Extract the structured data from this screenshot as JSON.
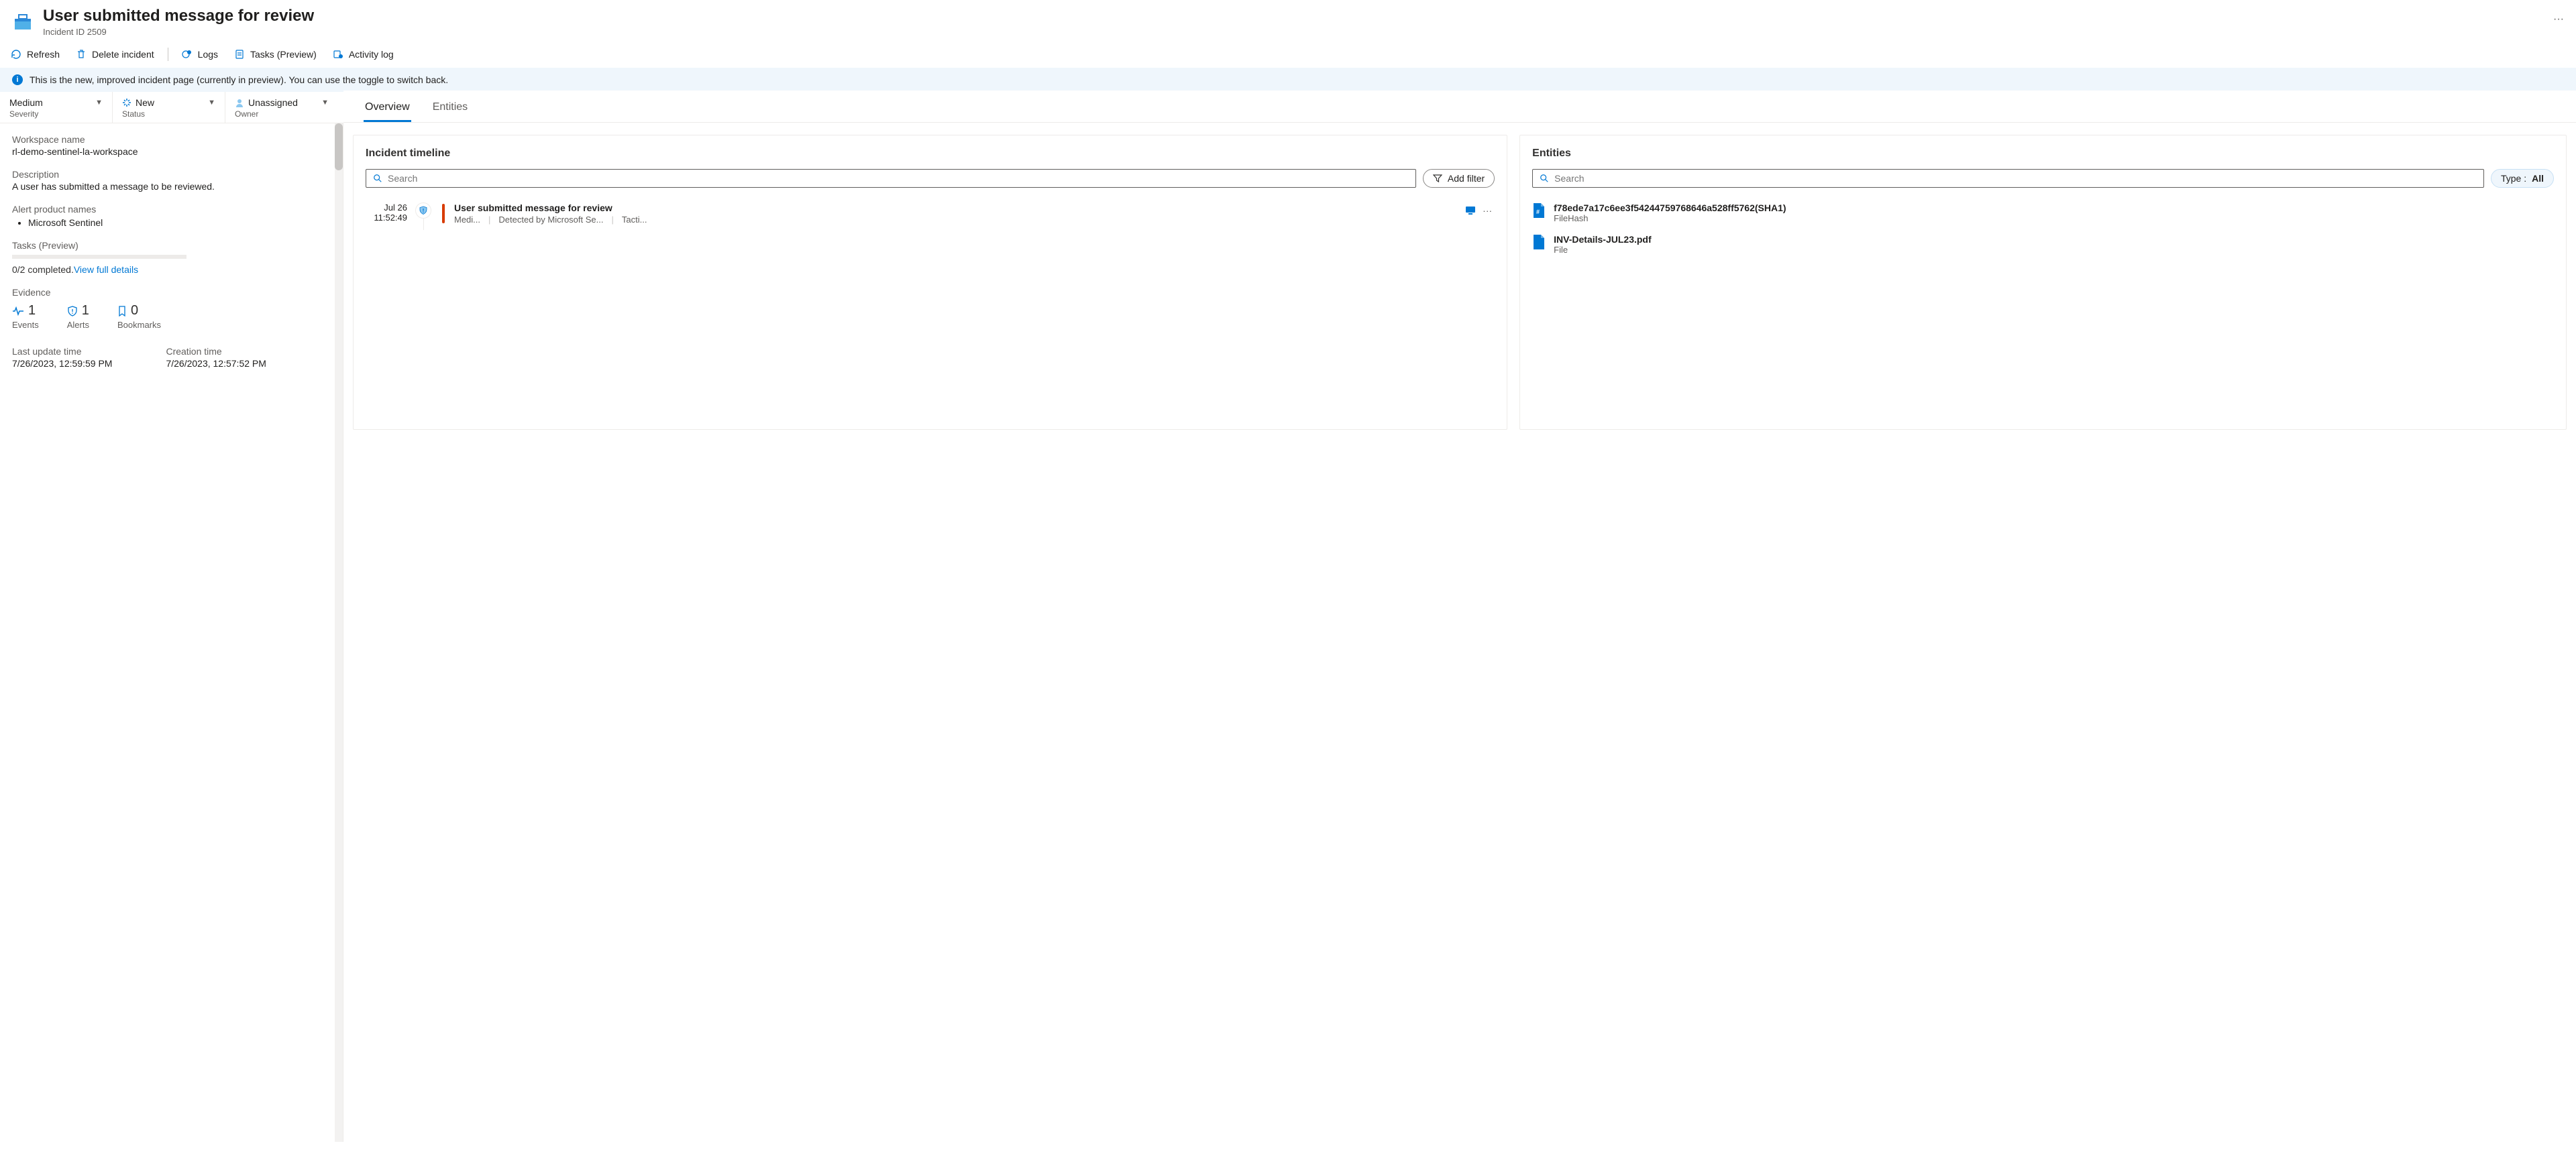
{
  "header": {
    "title": "User submitted message for review",
    "subtitle": "Incident ID 2509"
  },
  "toolbar": {
    "refresh": "Refresh",
    "delete": "Delete incident",
    "logs": "Logs",
    "tasks": "Tasks (Preview)",
    "activity": "Activity log"
  },
  "banner": {
    "text": "This is the new, improved incident page (currently in preview). You can use the toggle to switch back."
  },
  "selectors": {
    "severity": {
      "value": "Medium",
      "label": "Severity"
    },
    "status": {
      "value": "New",
      "label": "Status"
    },
    "owner": {
      "value": "Unassigned",
      "label": "Owner"
    }
  },
  "side": {
    "workspace_label": "Workspace name",
    "workspace_value": "rl-demo-sentinel-la-workspace",
    "description_label": "Description",
    "description_value": "A user has submitted a message to be reviewed.",
    "alert_products_label": "Alert product names",
    "alert_products": [
      "Microsoft Sentinel"
    ],
    "tasks_label": "Tasks (Preview)",
    "tasks_progress_text": "0/2 completed.",
    "tasks_link": "View full details",
    "evidence_label": "Evidence",
    "evidence": {
      "events": {
        "count": "1",
        "label": "Events"
      },
      "alerts": {
        "count": "1",
        "label": "Alerts"
      },
      "bookmarks": {
        "count": "0",
        "label": "Bookmarks"
      }
    },
    "last_update_label": "Last update time",
    "last_update_value": "7/26/2023, 12:59:59 PM",
    "creation_label": "Creation time",
    "creation_value": "7/26/2023, 12:57:52 PM"
  },
  "tabs": {
    "overview": "Overview",
    "entities": "Entities"
  },
  "timeline": {
    "title": "Incident timeline",
    "search_placeholder": "Search",
    "add_filter": "Add filter",
    "items": [
      {
        "date": "Jul 26",
        "time": "11:52:49",
        "title": "User submitted message for review",
        "severity": "Medi...",
        "detected": "Detected by Microsoft Se...",
        "tactics": "Tacti..."
      }
    ]
  },
  "entities_panel": {
    "title": "Entities",
    "search_placeholder": "Search",
    "type_label": "Type : ",
    "type_value": "All",
    "items": [
      {
        "title": "f78ede7a17c6ee3f54244759768646a528ff5762(SHA1)",
        "subtitle": "FileHash",
        "kind": "hash"
      },
      {
        "title": "INV-Details-JUL23.pdf",
        "subtitle": "File",
        "kind": "file"
      }
    ]
  }
}
